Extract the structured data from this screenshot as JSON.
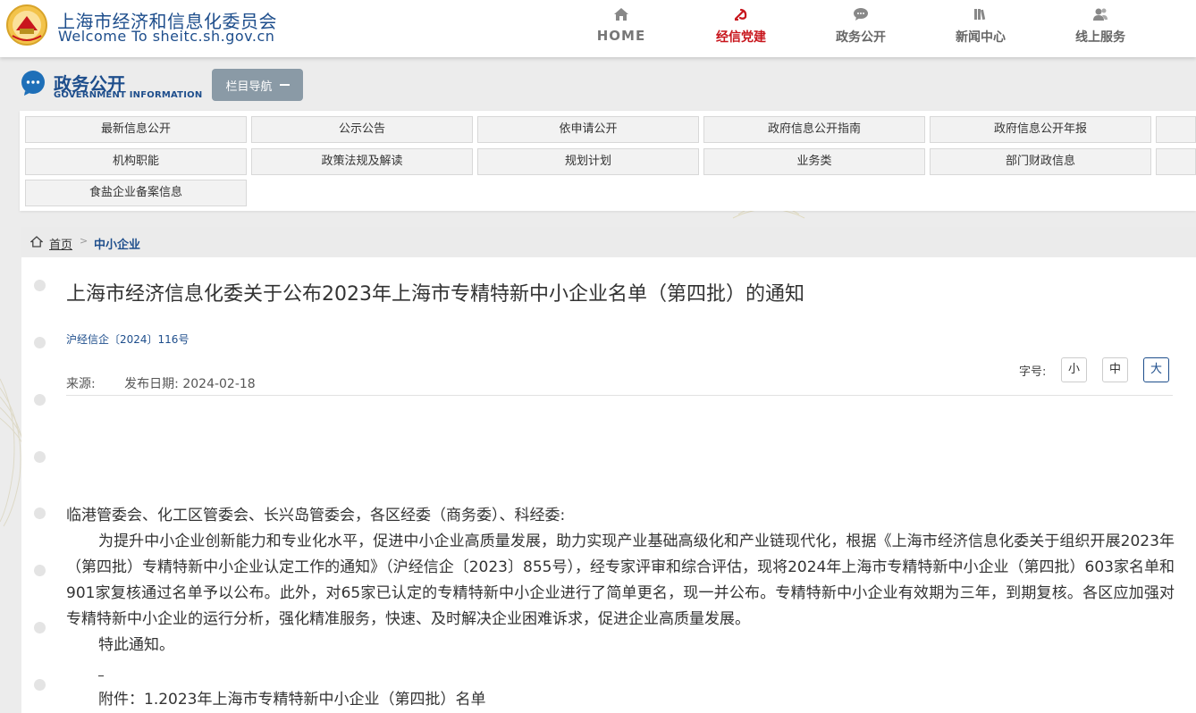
{
  "header": {
    "site_title": "上海市经济和信息化委员会",
    "site_subtitle": "Welcome To sheitc.sh.gov.cn",
    "nav": [
      {
        "label": "HOME",
        "icon": "home-icon"
      },
      {
        "label": "经信党建",
        "icon": "party-emblem-icon"
      },
      {
        "label": "政务公开",
        "icon": "chat-bubble-icon"
      },
      {
        "label": "新闻中心",
        "icon": "books-icon"
      },
      {
        "label": "线上服务",
        "icon": "users-icon"
      }
    ]
  },
  "section": {
    "title": "政务公开",
    "subtitle": "GOVERNMENT INFORMATION",
    "toggle_label": "栏目导航"
  },
  "categories": [
    "最新信息公开",
    "公示公告",
    "依申请公开",
    "政府信息公开指南",
    "政府信息公开年报",
    "机构职能",
    "政策法规及解读",
    "规划计划",
    "业务类",
    "部门财政信息",
    "食盐企业备案信息"
  ],
  "breadcrumb": {
    "home": "首页",
    "separator": ">",
    "current": "中小企业"
  },
  "article": {
    "title": "上海市经济信息化委关于公布2023年上海市专精特新中小企业名单（第四批）的通知",
    "doc_number": "沪经信企〔2024〕116号",
    "source_label": "来源:",
    "date_label": "发布日期:",
    "date": "2024-02-18",
    "font_size_label": "字号:",
    "font_sizes": [
      "小",
      "中",
      "大"
    ],
    "addressee": "临港管委会、化工区管委会、长兴岛管委会，各区经委（商务委）、科经委:",
    "paragraph": "为提升中小企业创新能力和专业化水平，促进中小企业高质量发展，助力实现产业基础高级化和产业链现代化，根据《上海市经济信息化委关于组织开展2023年（第四批）专精特新中小企业认定工作的通知》（沪经信企〔2023〕855号），经专家评审和综合评估，现将2024年上海市专精特新中小企业（第四批）603家名单和901家复核通过名单予以公布。此外，对65家已认定的专精特新中小企业进行了简单更名，现一并公布。专精特新中小企业有效期为三年，到期复核。各区应加强对专精特新中小企业的运行分析，强化精准服务，快速、及时解决企业困难诉求，促进企业高质量发展。",
    "closing": "特此通知。",
    "attachment": "附件：1.2023年上海市专精特新中小企业（第四批）名单"
  },
  "colors": {
    "brand_blue": "#1e4e8c",
    "active_red": "#c8161d",
    "toggle_gray": "#8a9aa6"
  }
}
